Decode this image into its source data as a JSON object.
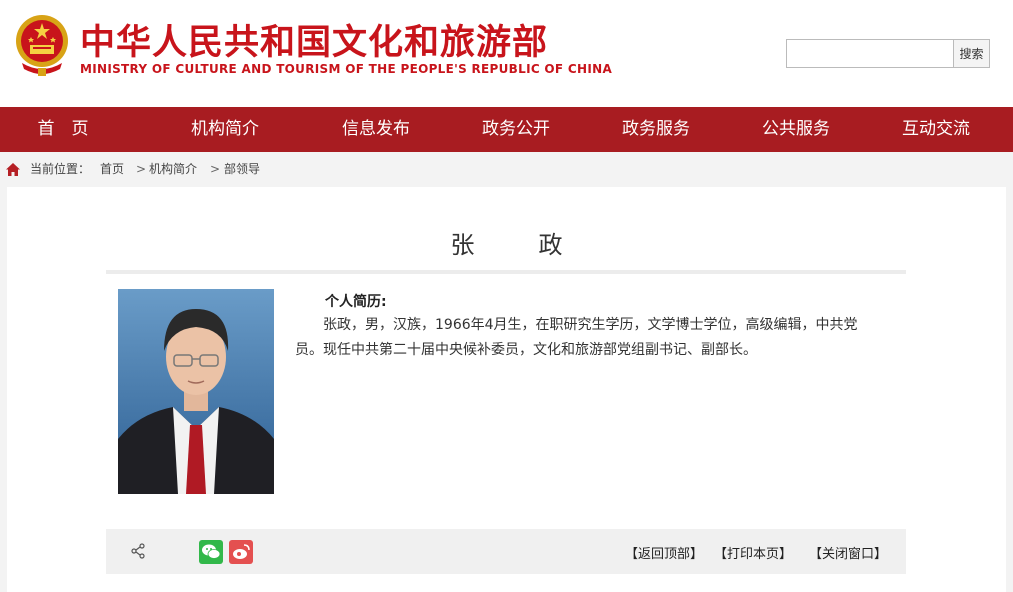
{
  "header": {
    "title_cn": "中华人民共和国文化和旅游部",
    "title_en": "MINISTRY OF CULTURE AND TOURISM OF THE PEOPLE'S REPUBLIC OF CHINA",
    "search_placeholder": "",
    "search_button": "搜索",
    "brand_color": "#c8141b"
  },
  "nav": {
    "items": [
      "首　页",
      "机构简介",
      "信息发布",
      "政务公开",
      "政务服务",
      "公共服务",
      "互动交流"
    ],
    "bg_color": "#a81c21"
  },
  "breadcrumb": {
    "label": "当前位置：",
    "items": [
      "首页",
      "机构简介",
      "部领导"
    ],
    "separator": ">"
  },
  "profile": {
    "name": "张　政",
    "bio_title": "个人简历:",
    "bio_text": "张政，男，汉族，1966年4月生，在职研究生学历，文学博士学位，高级编辑，中共党员。现任中共第二十届中央候补委员，文化和旅游部党组副书记、副部长。"
  },
  "toolbar": {
    "share_icon": "share-icon",
    "wechat_icon": "wechat-icon",
    "weibo_icon": "weibo-icon",
    "back_to_top": "【返回顶部】",
    "print_page": "【打印本页】",
    "close_window": "【关闭窗口】"
  }
}
